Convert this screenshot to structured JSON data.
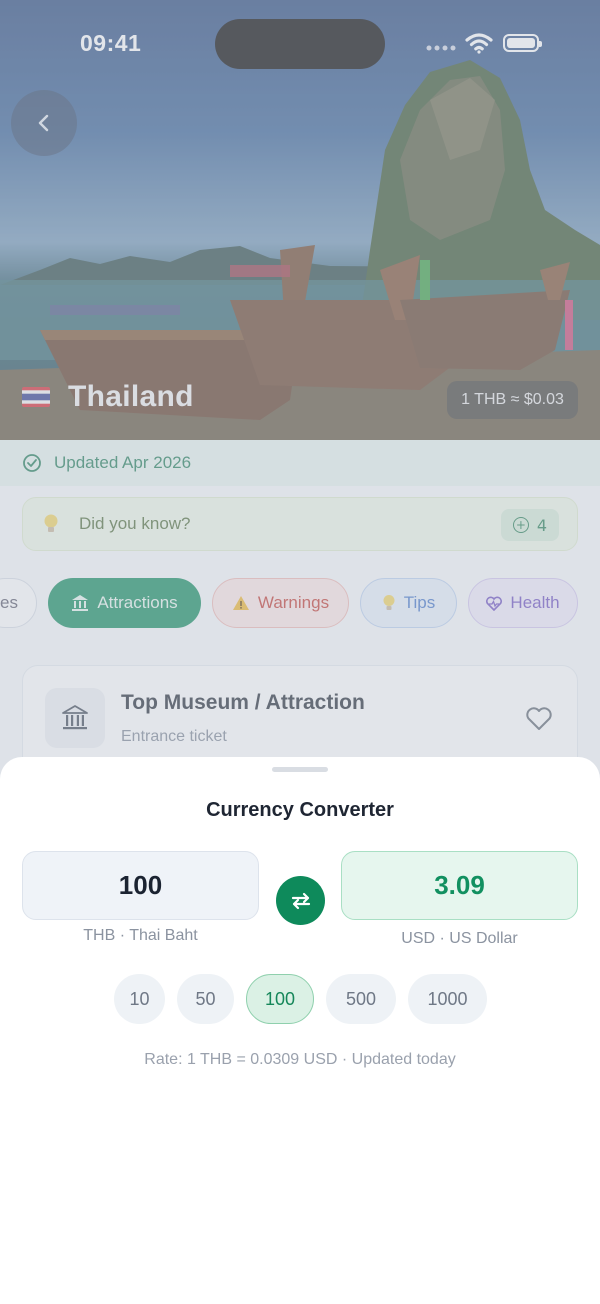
{
  "status_bar": {
    "time": "09:41"
  },
  "hero": {
    "country": "Thailand",
    "rate_chip": "1 THB ≈ $0.03"
  },
  "updated": "Updated Apr 2026",
  "did_you_know": {
    "label": "Did you know?",
    "count": "4"
  },
  "tabs": [
    {
      "label": "es"
    },
    {
      "label": "Attractions",
      "active": true
    },
    {
      "label": "Warnings"
    },
    {
      "label": "Tips"
    },
    {
      "label": "Health"
    }
  ],
  "card": {
    "title": "Top Museum / Attraction",
    "subtitle": "Entrance ticket"
  },
  "converter": {
    "title": "Currency Converter",
    "from": {
      "amount": "100",
      "label": "THB · Thai Baht"
    },
    "to": {
      "amount": "3.09",
      "label": "USD · US Dollar"
    },
    "quick_amounts": [
      "10",
      "50",
      "100",
      "500",
      "1000"
    ],
    "selected_quick_amount": "100",
    "rate_line": "Rate: 1 THB = 0.0309 USD · Updated today"
  },
  "colors": {
    "accent": "#0e8a5b",
    "warning": "#c4362c",
    "tips": "#3f72c8",
    "health": "#6a4bc0"
  }
}
